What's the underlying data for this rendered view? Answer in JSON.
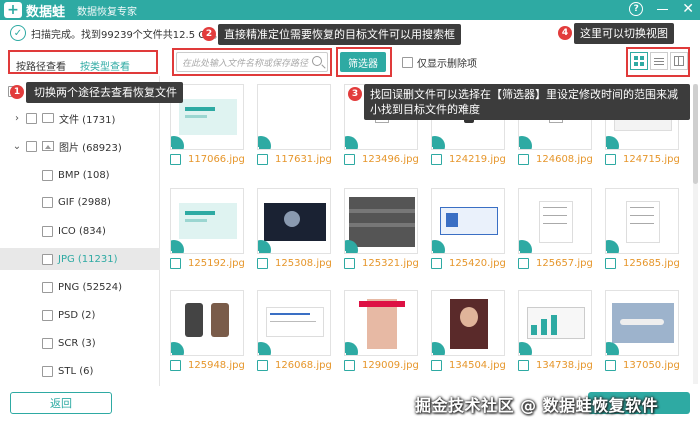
{
  "titlebar": {
    "logo_glyph": "+",
    "app_name": "数据蛙",
    "subtitle": "数据恢复专家",
    "help_glyph": "?",
    "close_glyph": "✕"
  },
  "scan_status": "扫描完成。找到99239个文件共12.5 GB。",
  "annotations": [
    {
      "num": "1",
      "text": "切换两个途径去查看恢复文件"
    },
    {
      "num": "2",
      "text": "直接精准定位需要恢复的目标文件可以用搜索框"
    },
    {
      "num": "3",
      "text": "找回误删文件可以选择在【筛选器】里设定修改时间的范围来减小找到目标文件的难度"
    },
    {
      "num": "4",
      "text": "这里可以切换视图"
    }
  ],
  "view_tabs": [
    {
      "label": "按路径查看",
      "active": false
    },
    {
      "label": "按类型查看",
      "active": true
    }
  ],
  "search": {
    "placeholder": "在此处输入文件名称或保存路径"
  },
  "filter_button": "筛选器",
  "deleted_only_label": "仅显示删除项",
  "tree": [
    {
      "label": "",
      "level": 0,
      "arrow": "",
      "icon": "",
      "top": 0
    },
    {
      "label": "文件 (1731)",
      "level": 1,
      "arrow": "›",
      "icon": "folder"
    },
    {
      "label": "图片 (68923)",
      "level": 1,
      "arrow": "⌄",
      "icon": "image"
    },
    {
      "label": "BMP (108)",
      "level": 2
    },
    {
      "label": "GIF (2988)",
      "level": 2
    },
    {
      "label": "ICO (834)",
      "level": 2
    },
    {
      "label": "JPG (11231)",
      "level": 2,
      "selected": true
    },
    {
      "label": "PNG (52524)",
      "level": 2
    },
    {
      "label": "PSD (2)",
      "level": 2
    },
    {
      "label": "SCR (3)",
      "level": 2
    },
    {
      "label": "STL (6)",
      "level": 2
    }
  ],
  "files": [
    {
      "name": "117066.jpg",
      "style": "teal-card"
    },
    {
      "name": "117631.jpg",
      "style": "blank"
    },
    {
      "name": "123496.jpg",
      "style": "small-doc"
    },
    {
      "name": "124219.jpg",
      "style": "phone"
    },
    {
      "name": "124608.jpg",
      "style": "small-doc",
      "selected": true
    },
    {
      "name": "124715.jpg",
      "style": "web-grid"
    },
    {
      "name": "125192.jpg",
      "style": "teal-card"
    },
    {
      "name": "125308.jpg",
      "style": "space"
    },
    {
      "name": "125321.jpg",
      "style": "tire"
    },
    {
      "name": "125420.jpg",
      "style": "blue-ui"
    },
    {
      "name": "125657.jpg",
      "style": "doc-lines"
    },
    {
      "name": "125685.jpg",
      "style": "doc-lines"
    },
    {
      "name": "125948.jpg",
      "style": "phones"
    },
    {
      "name": "126068.jpg",
      "style": "form"
    },
    {
      "name": "129009.jpg",
      "style": "person"
    },
    {
      "name": "134504.jpg",
      "style": "person2"
    },
    {
      "name": "134738.jpg",
      "style": "chart-ui"
    },
    {
      "name": "137050.jpg",
      "style": "plane"
    }
  ],
  "back_button": "返回",
  "watermark": "掘金技术社区 @ 数据蛙恢复软件",
  "colors": {
    "accent": "#2eaaa3",
    "annotation_red": "#e03a3a",
    "file_name": "#e6962b"
  }
}
